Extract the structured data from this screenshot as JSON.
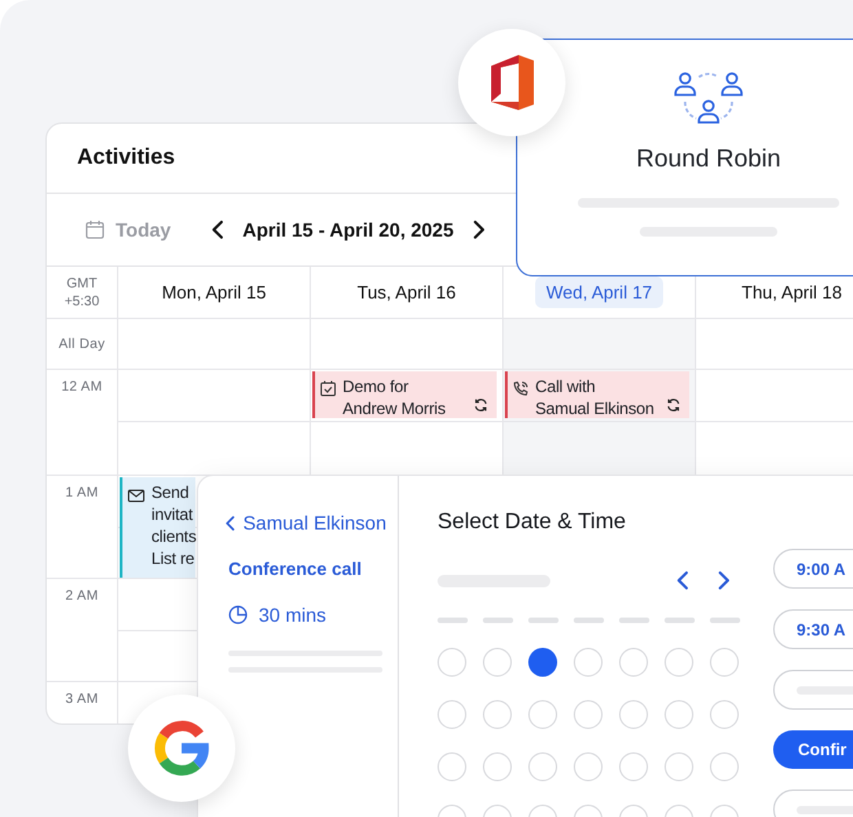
{
  "activities": {
    "title": "Activities",
    "today": "Today",
    "range": "April 15 - April 20, 2025",
    "timezone": "GMT +5:30",
    "days": [
      {
        "label": "Mon, April 15",
        "selected": false
      },
      {
        "label": "Tus, April 16",
        "selected": false
      },
      {
        "label": "Wed, April 17",
        "selected": true
      },
      {
        "label": "Thu, April 18",
        "selected": false
      }
    ],
    "rows": [
      {
        "label": "All Day",
        "kind": "allday",
        "cells": [
          {
            "kind": "empty"
          },
          {
            "kind": "empty"
          },
          {
            "kind": "empty"
          },
          {
            "kind": "empty"
          }
        ]
      },
      {
        "label": "12 AM",
        "kind": "hour",
        "cells": [
          {
            "kind": "empty"
          },
          {
            "kind": "event",
            "event": {
              "kind": "task",
              "color": "#d9434f",
              "lines": [
                "Demo for",
                "Andrew Morris"
              ],
              "recurring": true
            }
          },
          {
            "kind": "event",
            "event": {
              "kind": "call",
              "color": "#d9434f",
              "lines": [
                "Call with",
                "Samual Elkinson"
              ],
              "recurring": true
            }
          },
          {
            "kind": "empty"
          }
        ]
      },
      {
        "label": "1 AM",
        "kind": "hour",
        "cells": [
          {
            "kind": "event",
            "event": {
              "kind": "email",
              "color": "#1fb5c4",
              "lines": [
                "Send",
                "invitat",
                "clients",
                "List re"
              ],
              "recurring": false
            }
          },
          {
            "kind": "empty"
          },
          {
            "kind": "empty"
          },
          {
            "kind": "empty"
          }
        ]
      },
      {
        "label": "2 AM",
        "kind": "hour",
        "cells": [
          {
            "kind": "empty"
          },
          {
            "kind": "empty"
          },
          {
            "kind": "empty"
          },
          {
            "kind": "empty"
          }
        ]
      },
      {
        "label": "3 AM",
        "kind": "short",
        "cells": [
          {
            "kind": "empty"
          },
          {
            "kind": "empty"
          },
          {
            "kind": "empty"
          },
          {
            "kind": "empty"
          }
        ]
      }
    ]
  },
  "round_robin": {
    "title": "Round Robin"
  },
  "booking": {
    "back": "Samual Elkinson",
    "event_type": "Conference call",
    "duration": "30 mins",
    "title": "Select Date & Time",
    "dates": [
      {
        "selected": false
      },
      {
        "selected": false
      },
      {
        "selected": true
      },
      {
        "selected": false
      },
      {
        "selected": false
      },
      {
        "selected": false
      },
      {
        "selected": false
      },
      {
        "selected": false
      },
      {
        "selected": false
      },
      {
        "selected": false
      },
      {
        "selected": false
      },
      {
        "selected": false
      },
      {
        "selected": false
      },
      {
        "selected": false
      },
      {
        "selected": false
      },
      {
        "selected": false
      },
      {
        "selected": false
      },
      {
        "selected": false
      },
      {
        "selected": false
      },
      {
        "selected": false
      },
      {
        "selected": false
      },
      {
        "selected": false
      },
      {
        "selected": false
      },
      {
        "selected": false
      },
      {
        "selected": false
      },
      {
        "selected": false
      },
      {
        "selected": false
      },
      {
        "selected": false
      }
    ],
    "slots": [
      {
        "kind": "time",
        "label": "9:00 A"
      },
      {
        "kind": "time",
        "label": "9:30 A"
      },
      {
        "kind": "blank"
      },
      {
        "kind": "confirm",
        "label": "Confir"
      },
      {
        "kind": "blank"
      }
    ]
  }
}
